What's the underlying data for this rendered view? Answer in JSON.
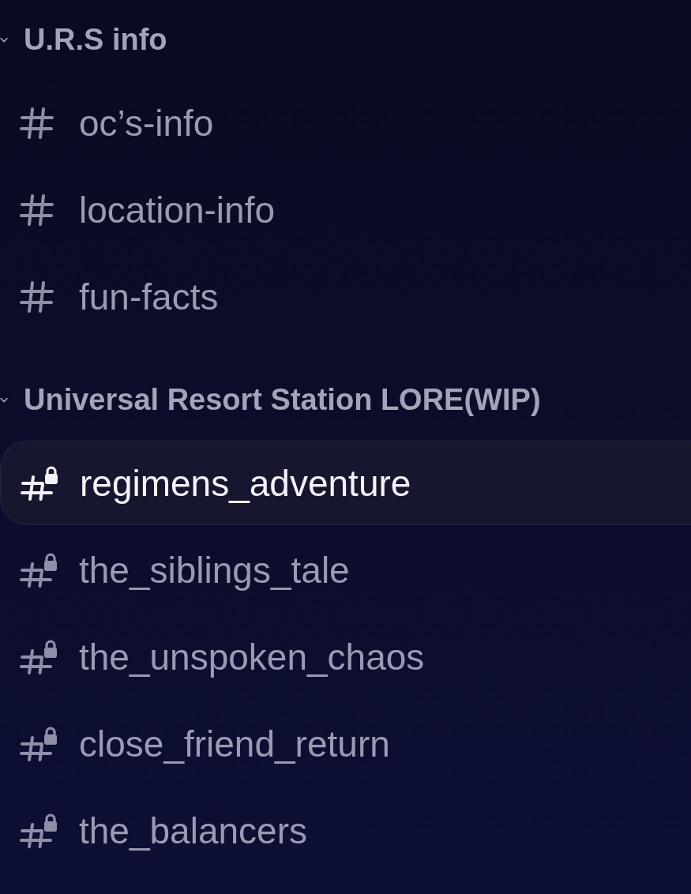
{
  "categories": [
    {
      "name": "U.R.S info",
      "expanded": true,
      "channels": [
        {
          "name": "oc’s-info",
          "kind": "text",
          "selected": false
        },
        {
          "name": "location-info",
          "kind": "text",
          "selected": false
        },
        {
          "name": "fun-facts",
          "kind": "text",
          "selected": false
        }
      ]
    },
    {
      "name": "Universal Resort Station LORE(WIP)",
      "expanded": true,
      "channels": [
        {
          "name": "regimens_adventure",
          "kind": "locked",
          "selected": true
        },
        {
          "name": "the_siblings_tale",
          "kind": "locked",
          "selected": false
        },
        {
          "name": "the_unspoken_chaos",
          "kind": "locked",
          "selected": false
        },
        {
          "name": "close_friend_return",
          "kind": "locked",
          "selected": false
        },
        {
          "name": "the_balancers",
          "kind": "locked",
          "selected": false
        }
      ]
    }
  ]
}
